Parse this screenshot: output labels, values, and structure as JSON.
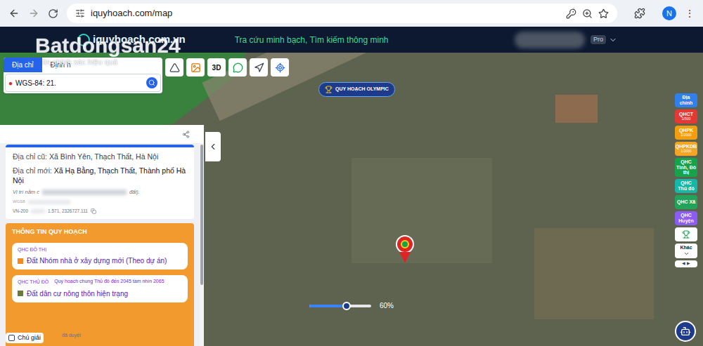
{
  "browser": {
    "url": "iquyhoach.com/map",
    "avatar": "N"
  },
  "header": {
    "logo": "iquyhoach.com.vn",
    "tagline": "Tra cứu minh bạch, Tìm kiếm thông minh",
    "plan": "Pro"
  },
  "watermark": {
    "brand": "Batdongsan24",
    "slogan": "tin chính xác hiệu quả"
  },
  "search": {
    "tabs": [
      {
        "label": "Địa chỉ",
        "selected": true
      },
      {
        "label": "Định h",
        "selected": false
      }
    ],
    "value": "WGS-84: 21."
  },
  "toolbar": [
    {
      "kind": "measure"
    },
    {
      "kind": "photo"
    },
    {
      "kind": "text",
      "label": "3D"
    },
    {
      "kind": "chat"
    },
    {
      "kind": "compass"
    },
    {
      "kind": "locate"
    }
  ],
  "map": {
    "label": "QUY HOẠCH OLYMPIC",
    "opacity": {
      "level": 0.6,
      "reading": "60%"
    }
  },
  "panel": {
    "old_label": "Địa chỉ cũ:",
    "old_value": "Xã Bình Yên, Thạch Thất, Hà Nội",
    "new_label": "Địa chỉ mới:",
    "new_value": "Xã Hạ Bằng, Thạch Thất, Thành phố Hà Nội",
    "note_start": "Vị trí nằm c",
    "note_end": "đất).",
    "wgs_label": "WGS8",
    "vn_label": "VN-200",
    "vn_value": "1.571, 2326727.111"
  },
  "planning": {
    "title": "THÔNG TIN QUY HOẠCH",
    "cards": [
      {
        "tag": "QHC ĐÔ THỊ",
        "subtitle": "",
        "value": "Đất Nhóm nhà ở xây dựng mới (Theo dự án)",
        "color": "#f08a24"
      },
      {
        "tag": "QHC THỦ ĐÔ",
        "subtitle": "Quy hoạch chung Thủ đô đến 2045 tầm nhìn 2065",
        "value": "Đất dân cư nông thôn hiện trạng",
        "color": "#6b7a3a"
      }
    ]
  },
  "legend": {
    "label": "Chú giải",
    "note": "đã duyệt"
  },
  "layers": [
    {
      "label": "Địa chính",
      "sub": "",
      "color": "#2f80ed"
    },
    {
      "label": "QHCT",
      "sub": "1/500",
      "color": "#e53935"
    },
    {
      "label": "QHPK",
      "sub": "1/2000",
      "color": "#f59e0b"
    },
    {
      "label": "QHPKDB",
      "sub": "1/2000",
      "color": "#f5a524"
    },
    {
      "label": "QHC Tỉnh, Đô thị",
      "sub": "",
      "color": "#16a34a"
    },
    {
      "label": "QHC Thủ đô",
      "sub": "",
      "color": "#14b8a6"
    },
    {
      "label": "QHC Xã",
      "sub": "",
      "color": "#22a35a"
    },
    {
      "label": "QHC Huyện",
      "sub": "",
      "color": "#8b5cf6"
    },
    {
      "label": "",
      "sub": "",
      "color": "#ffffff"
    },
    {
      "label": "Khác",
      "sub": "",
      "color": "#ffffff"
    }
  ]
}
